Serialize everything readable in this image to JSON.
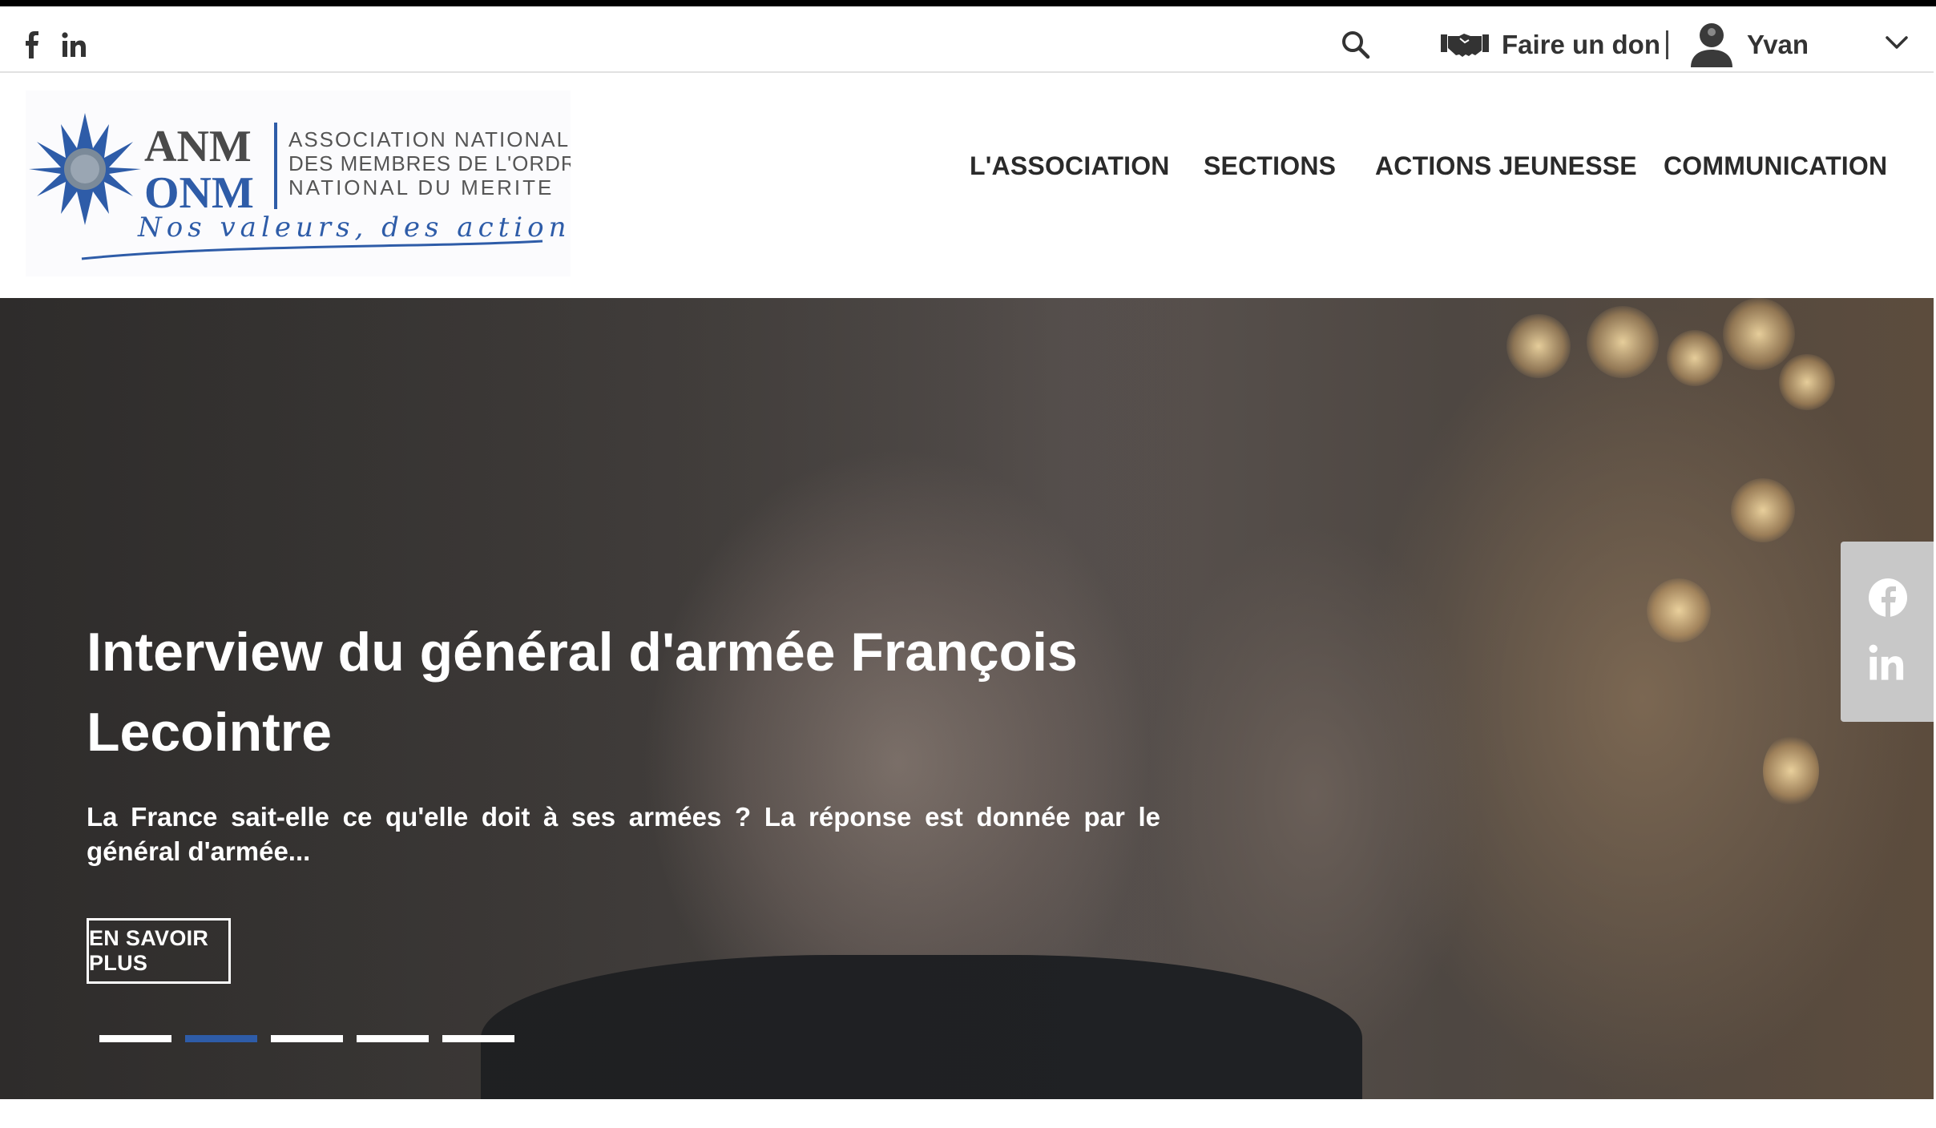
{
  "colors": {
    "brand_blue": "#2e5ca8",
    "nav_text": "#2a2a2a",
    "share_bg": "#c8c8c8"
  },
  "utility_bar": {
    "social": [
      {
        "name": "facebook-icon"
      },
      {
        "name": "linkedin-icon"
      }
    ],
    "search_icon": "search-icon",
    "donate_label": "Faire un don",
    "separator": "|",
    "user_name": "Yvan"
  },
  "logo": {
    "acronym_top": "ANM",
    "acronym_bottom": "ONM",
    "line1": "ASSOCIATION NATIONALE",
    "line2": "DES MEMBRES DE L'ORDRE",
    "line3": "NATIONAL DU MERITE",
    "tagline": "Nos valeurs, des actions"
  },
  "nav": {
    "items": [
      {
        "label": "L'ASSOCIATION"
      },
      {
        "label": "SECTIONS"
      },
      {
        "label": "ACTIONS JEUNESSE"
      },
      {
        "label": "COMMUNICATION"
      }
    ]
  },
  "hero": {
    "title": "Interview du général d'armée François Lecointre",
    "description": "La France sait-elle ce qu'elle doit à ses armées ? La réponse est donnée par le général d'armée...",
    "cta_label": "EN SAVOIR PLUS",
    "slide_count": 5,
    "active_slide": 2
  },
  "share_panel": {
    "icons": [
      "facebook-icon",
      "linkedin-icon"
    ]
  }
}
